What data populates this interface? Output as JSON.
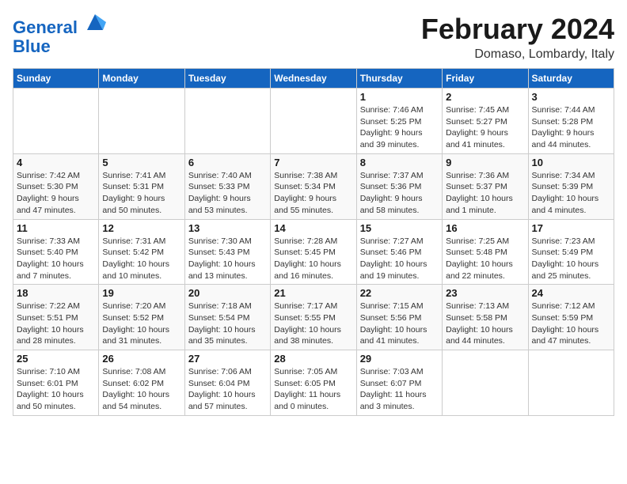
{
  "logo": {
    "line1": "General",
    "line2": "Blue"
  },
  "title": "February 2024",
  "location": "Domaso, Lombardy, Italy",
  "weekdays": [
    "Sunday",
    "Monday",
    "Tuesday",
    "Wednesday",
    "Thursday",
    "Friday",
    "Saturday"
  ],
  "weeks": [
    [
      {
        "day": "",
        "info": ""
      },
      {
        "day": "",
        "info": ""
      },
      {
        "day": "",
        "info": ""
      },
      {
        "day": "",
        "info": ""
      },
      {
        "day": "1",
        "info": "Sunrise: 7:46 AM\nSunset: 5:25 PM\nDaylight: 9 hours\nand 39 minutes."
      },
      {
        "day": "2",
        "info": "Sunrise: 7:45 AM\nSunset: 5:27 PM\nDaylight: 9 hours\nand 41 minutes."
      },
      {
        "day": "3",
        "info": "Sunrise: 7:44 AM\nSunset: 5:28 PM\nDaylight: 9 hours\nand 44 minutes."
      }
    ],
    [
      {
        "day": "4",
        "info": "Sunrise: 7:42 AM\nSunset: 5:30 PM\nDaylight: 9 hours\nand 47 minutes."
      },
      {
        "day": "5",
        "info": "Sunrise: 7:41 AM\nSunset: 5:31 PM\nDaylight: 9 hours\nand 50 minutes."
      },
      {
        "day": "6",
        "info": "Sunrise: 7:40 AM\nSunset: 5:33 PM\nDaylight: 9 hours\nand 53 minutes."
      },
      {
        "day": "7",
        "info": "Sunrise: 7:38 AM\nSunset: 5:34 PM\nDaylight: 9 hours\nand 55 minutes."
      },
      {
        "day": "8",
        "info": "Sunrise: 7:37 AM\nSunset: 5:36 PM\nDaylight: 9 hours\nand 58 minutes."
      },
      {
        "day": "9",
        "info": "Sunrise: 7:36 AM\nSunset: 5:37 PM\nDaylight: 10 hours\nand 1 minute."
      },
      {
        "day": "10",
        "info": "Sunrise: 7:34 AM\nSunset: 5:39 PM\nDaylight: 10 hours\nand 4 minutes."
      }
    ],
    [
      {
        "day": "11",
        "info": "Sunrise: 7:33 AM\nSunset: 5:40 PM\nDaylight: 10 hours\nand 7 minutes."
      },
      {
        "day": "12",
        "info": "Sunrise: 7:31 AM\nSunset: 5:42 PM\nDaylight: 10 hours\nand 10 minutes."
      },
      {
        "day": "13",
        "info": "Sunrise: 7:30 AM\nSunset: 5:43 PM\nDaylight: 10 hours\nand 13 minutes."
      },
      {
        "day": "14",
        "info": "Sunrise: 7:28 AM\nSunset: 5:45 PM\nDaylight: 10 hours\nand 16 minutes."
      },
      {
        "day": "15",
        "info": "Sunrise: 7:27 AM\nSunset: 5:46 PM\nDaylight: 10 hours\nand 19 minutes."
      },
      {
        "day": "16",
        "info": "Sunrise: 7:25 AM\nSunset: 5:48 PM\nDaylight: 10 hours\nand 22 minutes."
      },
      {
        "day": "17",
        "info": "Sunrise: 7:23 AM\nSunset: 5:49 PM\nDaylight: 10 hours\nand 25 minutes."
      }
    ],
    [
      {
        "day": "18",
        "info": "Sunrise: 7:22 AM\nSunset: 5:51 PM\nDaylight: 10 hours\nand 28 minutes."
      },
      {
        "day": "19",
        "info": "Sunrise: 7:20 AM\nSunset: 5:52 PM\nDaylight: 10 hours\nand 31 minutes."
      },
      {
        "day": "20",
        "info": "Sunrise: 7:18 AM\nSunset: 5:54 PM\nDaylight: 10 hours\nand 35 minutes."
      },
      {
        "day": "21",
        "info": "Sunrise: 7:17 AM\nSunset: 5:55 PM\nDaylight: 10 hours\nand 38 minutes."
      },
      {
        "day": "22",
        "info": "Sunrise: 7:15 AM\nSunset: 5:56 PM\nDaylight: 10 hours\nand 41 minutes."
      },
      {
        "day": "23",
        "info": "Sunrise: 7:13 AM\nSunset: 5:58 PM\nDaylight: 10 hours\nand 44 minutes."
      },
      {
        "day": "24",
        "info": "Sunrise: 7:12 AM\nSunset: 5:59 PM\nDaylight: 10 hours\nand 47 minutes."
      }
    ],
    [
      {
        "day": "25",
        "info": "Sunrise: 7:10 AM\nSunset: 6:01 PM\nDaylight: 10 hours\nand 50 minutes."
      },
      {
        "day": "26",
        "info": "Sunrise: 7:08 AM\nSunset: 6:02 PM\nDaylight: 10 hours\nand 54 minutes."
      },
      {
        "day": "27",
        "info": "Sunrise: 7:06 AM\nSunset: 6:04 PM\nDaylight: 10 hours\nand 57 minutes."
      },
      {
        "day": "28",
        "info": "Sunrise: 7:05 AM\nSunset: 6:05 PM\nDaylight: 11 hours\nand 0 minutes."
      },
      {
        "day": "29",
        "info": "Sunrise: 7:03 AM\nSunset: 6:07 PM\nDaylight: 11 hours\nand 3 minutes."
      },
      {
        "day": "",
        "info": ""
      },
      {
        "day": "",
        "info": ""
      }
    ]
  ]
}
